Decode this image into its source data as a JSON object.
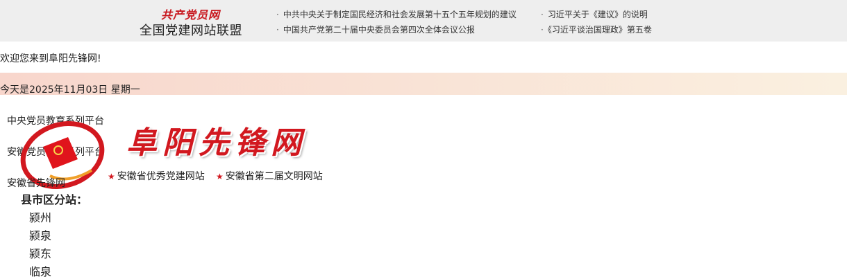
{
  "topbar": {
    "logo_text": "共产党员网",
    "alliance_name": "全国党建网站联盟",
    "news": [
      "中共中央关于制定国民经济和社会发展第十五个五年规划的建议",
      "中国共产党第二十届中央委员会第四次全体会议公报",
      "习近平关于《建议》的说明",
      "《习近平谈治国理政》第五卷"
    ]
  },
  "welcome_text": "欢迎您来到阜阳先锋网!",
  "date_text": "今天是2025年11月03日 星期一",
  "platforms": [
    "中央党员教育系列平台",
    "安徽党员教育系列平台",
    "安徽省先锋网"
  ],
  "site": {
    "title": "阜阳先锋网",
    "honors": [
      "安徽省优秀党建网站",
      "安徽省第二届文明网站"
    ]
  },
  "subsites": {
    "title": "县市区分站：",
    "items": [
      "颍州",
      "颍泉",
      "颍东",
      "临泉"
    ]
  },
  "colors": {
    "accent": "#d2181f",
    "topbar_bg": "#eeeeee"
  }
}
